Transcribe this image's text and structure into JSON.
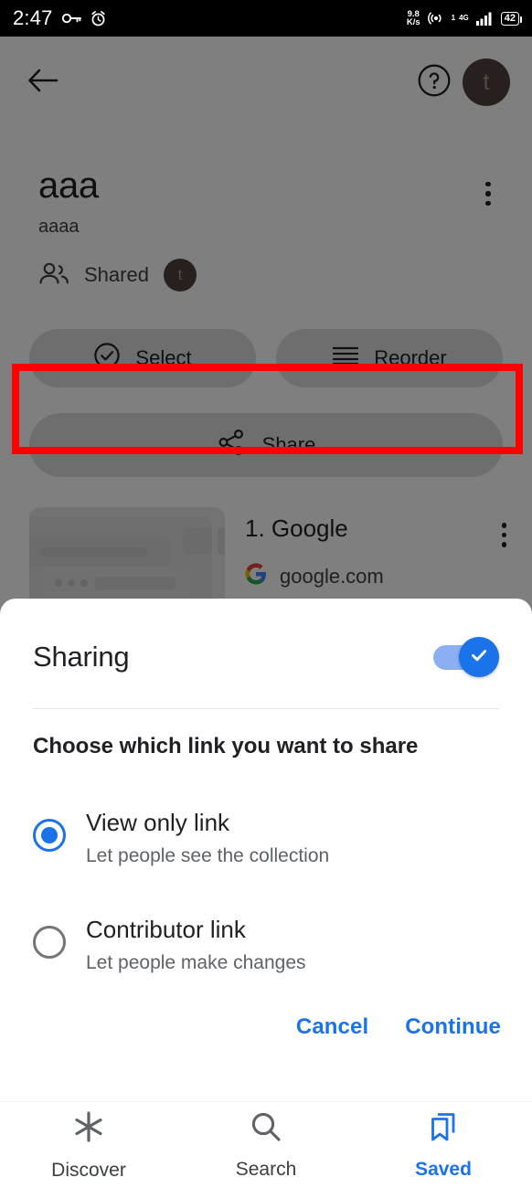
{
  "status_bar": {
    "time": "2:47",
    "vpn_icon": "key-icon",
    "alarm_icon": "alarm-icon",
    "net_speed_value": "9.8",
    "net_speed_unit": "K/s",
    "hotspot_icon": "hotspot-icon",
    "sim_label": "1",
    "network_type": "4G",
    "signal_icon": "signal-bars-icon",
    "battery_level": "42"
  },
  "app_bar": {
    "back_icon": "back-arrow-icon",
    "help_icon": "help-circle-icon",
    "avatar_initial": "t",
    "avatar_color": "#4e403c"
  },
  "collection": {
    "title": "aaa",
    "subtitle": "aaaa",
    "shared_icon": "people-icon",
    "shared_label": "Shared",
    "shared_avatar_initial": "t",
    "overflow_icon": "more-vertical-icon"
  },
  "actions": {
    "select_label": "Select",
    "select_icon": "check-circle-icon",
    "reorder_label": "Reorder",
    "reorder_icon": "reorder-lines-icon",
    "share_label": "Share",
    "share_icon": "share-nodes-icon"
  },
  "highlight": {
    "color": "#fe0000"
  },
  "list": {
    "items": [
      {
        "title": "1. Google",
        "url": "google.com",
        "favicon": "google-g-icon",
        "overflow_icon": "more-vertical-icon"
      }
    ]
  },
  "sheet": {
    "title": "Sharing",
    "toggle_on": true,
    "toggle_check_icon": "check-icon",
    "subtitle": "Choose which link you want to share",
    "options": [
      {
        "label": "View only link",
        "description": "Let people see the collection",
        "selected": true
      },
      {
        "label": "Contributor link",
        "description": "Let people make changes",
        "selected": false
      }
    ],
    "cancel_label": "Cancel",
    "continue_label": "Continue",
    "accent_color": "#1a73e8"
  },
  "bottom_nav": {
    "items": [
      {
        "label": "Discover",
        "icon": "asterisk-icon",
        "active": false
      },
      {
        "label": "Search",
        "icon": "search-icon",
        "active": false
      },
      {
        "label": "Saved",
        "icon": "collections-bookmark-icon",
        "active": true
      }
    ]
  }
}
